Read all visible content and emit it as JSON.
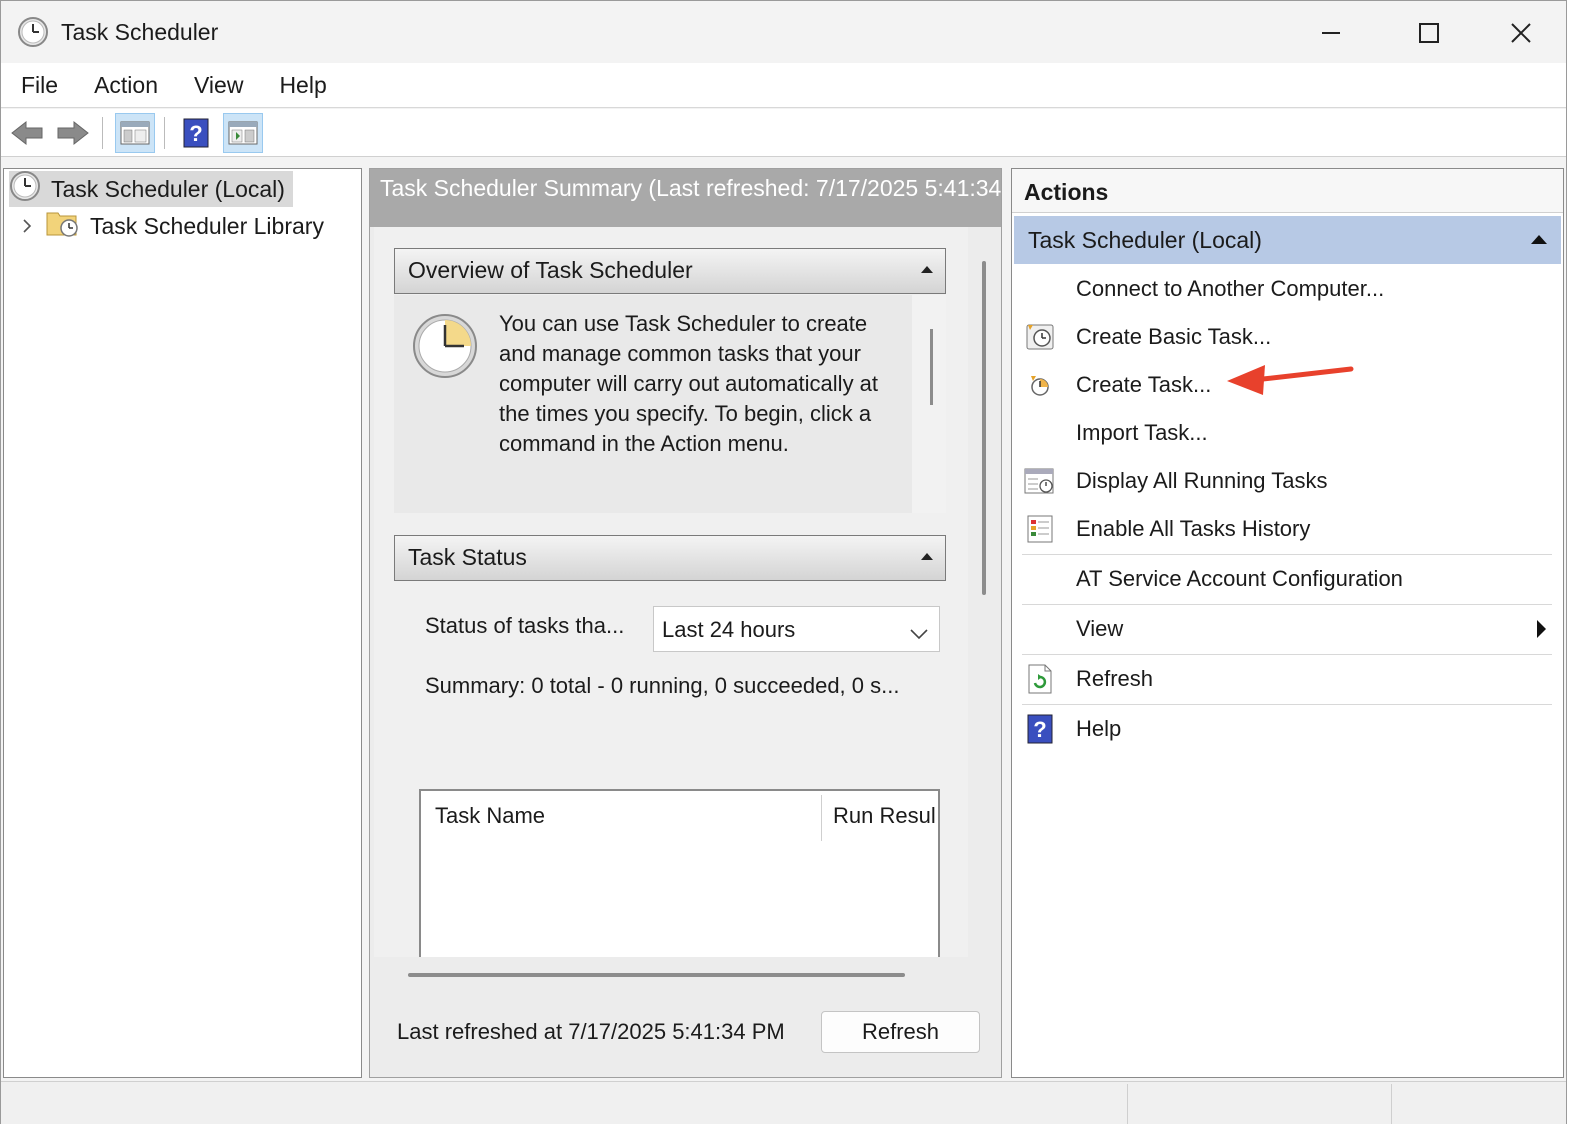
{
  "window": {
    "title": "Task Scheduler"
  },
  "window_controls": {
    "minimize": "—",
    "maximize": "☐",
    "close": "✕"
  },
  "menu": [
    "File",
    "Action",
    "View",
    "Help"
  ],
  "toolbar": {
    "buttons": [
      "back-arrow-icon",
      "forward-arrow-icon",
      "show-hide-console-tree-icon",
      "help-icon",
      "show-hide-action-pane-icon"
    ]
  },
  "tree": {
    "root_label": "Task Scheduler (Local)",
    "library_label": "Task Scheduler Library",
    "expander": "›"
  },
  "summary": {
    "header": "Task Scheduler Summary (Last refreshed: 7/17/2025 5:41:34",
    "overview": {
      "title": "Overview of Task Scheduler",
      "text": "You can use Task Scheduler to create and manage common tasks that your computer will carry out automatically at the times you specify. To begin, click a command in the Action menu."
    },
    "task_status": {
      "title": "Task Status",
      "filter_label": "Status of tasks tha...",
      "filter_value": "Last 24 hours",
      "summary": "Summary: 0 total - 0 running, 0 succeeded, 0 s...",
      "columns": [
        "Task Name",
        "Run Resul"
      ]
    },
    "last_refreshed": "Last refreshed at 7/17/2025 5:41:34 PM",
    "refresh_button": "Refresh"
  },
  "actions": {
    "title": "Actions",
    "group": "Task Scheduler (Local)",
    "items": [
      {
        "label": "Connect to Another Computer...",
        "icon": ""
      },
      {
        "label": "Create Basic Task...",
        "icon": "create-basic-task-icon"
      },
      {
        "label": "Create Task...",
        "icon": "create-task-icon"
      },
      {
        "label": "Import Task...",
        "icon": ""
      },
      {
        "label": "Display All Running Tasks",
        "icon": "running-tasks-icon"
      },
      {
        "label": "Enable All Tasks History",
        "icon": "tasks-history-icon"
      },
      {
        "label": "AT Service Account Configuration",
        "icon": ""
      },
      {
        "label": "View",
        "icon": ""
      },
      {
        "label": "Refresh",
        "icon": "refresh-icon"
      },
      {
        "label": "Help",
        "icon": "help-icon"
      }
    ]
  },
  "colors": {
    "accent_selected_group": "#b7c9e5",
    "annotation_arrow": "#e8412c",
    "help_icon": "#3a4fbf"
  }
}
